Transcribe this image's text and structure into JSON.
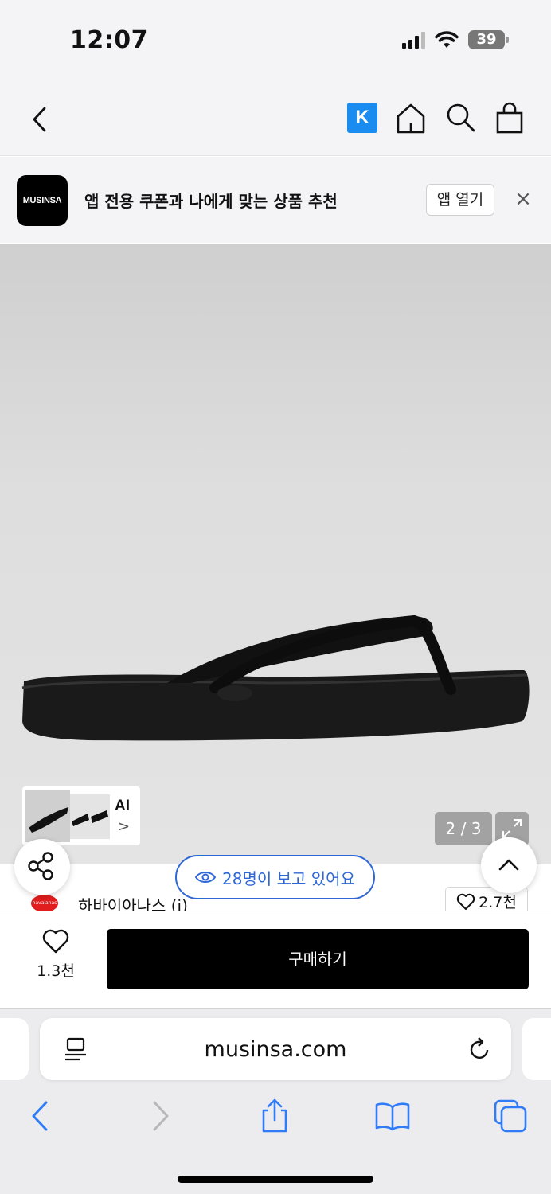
{
  "status_bar": {
    "time": "12:07",
    "battery": "39"
  },
  "nav": {
    "k_badge": "K"
  },
  "app_banner": {
    "logo_text": "MUSINSA",
    "text": "앱 전용 쿠폰과 나에게 맞는 상품 추천",
    "open_label": "앱 열기",
    "close_label": "×"
  },
  "product": {
    "thumb_label": "AI",
    "thumb_arrow": ">",
    "page_counter": "2 / 3",
    "viewers_text": "28명이 보고 있어요"
  },
  "brand": {
    "logo_text": "havaianas",
    "name": "하바이아나스 (i)",
    "like_count": "2.7천"
  },
  "purchase": {
    "wish_count": "1.3천",
    "buy_label": "구매하기"
  },
  "browser": {
    "url": "musinsa.com"
  }
}
